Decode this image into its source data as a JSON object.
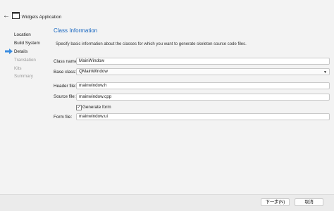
{
  "window": {
    "title": "t Widgets Application",
    "back_icon": "arrow-left-icon",
    "app_icon": "window-icon"
  },
  "sidebar": {
    "items": [
      {
        "label": "Location",
        "state": "done"
      },
      {
        "label": "Build System",
        "state": "done"
      },
      {
        "label": "Details",
        "state": "current"
      },
      {
        "label": "Translation",
        "state": "pending"
      },
      {
        "label": "Kits",
        "state": "pending"
      },
      {
        "label": "Summary",
        "state": "pending"
      }
    ],
    "current_indicator_icon": "arrow-right-icon"
  },
  "page": {
    "heading": "Class Information",
    "description": "Specify basic information about the classes for which you want to generate skeleton source code files."
  },
  "form": {
    "class_name_label": "Class name:",
    "class_name_value": "MainWindow",
    "base_class_label": "Base class:",
    "base_class_value": "QMainWindow",
    "header_file_label": "Header file:",
    "header_file_value": "mainwindow.h",
    "source_file_label": "Source file:",
    "source_file_value": "mainwindow.cpp",
    "generate_form_label": "Generate form",
    "generate_form_checked": true,
    "form_file_label": "Form file:",
    "form_file_value": "mainwindow.ui"
  },
  "footer": {
    "next_label": "下一步(N)",
    "cancel_label": "取消"
  },
  "colors": {
    "accent": "#1565c0",
    "background": "#f3f3f3",
    "dim_text": "#9a9a9a"
  }
}
